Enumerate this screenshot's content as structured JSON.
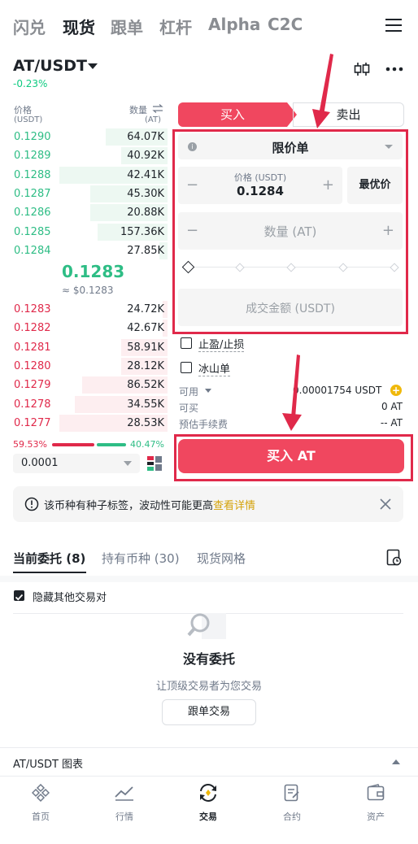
{
  "top_nav": {
    "tabs": [
      {
        "label": "闪兑",
        "active": false
      },
      {
        "label": "现货",
        "active": true
      },
      {
        "label": "跟单",
        "active": false
      },
      {
        "label": "杠杆",
        "active": false
      },
      {
        "label": "Alpha",
        "active": false
      },
      {
        "label": "C2C",
        "active": false
      }
    ],
    "menu_icon": "hamburger-icon"
  },
  "header": {
    "pair": "AT/USDT",
    "change": "-0.23%",
    "icons": [
      "candlestick-icon",
      "more-icon"
    ]
  },
  "orderbook": {
    "price_header": "价格",
    "price_unit": "(USDT)",
    "qty_header": "数量",
    "qty_unit": "(AT)",
    "bids": [
      {
        "price": "0.1290",
        "qty": "64.07K",
        "depth": 0.4
      },
      {
        "price": "0.1289",
        "qty": "40.92K",
        "depth": 0.3
      },
      {
        "price": "0.1288",
        "qty": "42.41K",
        "depth": 0.7
      },
      {
        "price": "0.1287",
        "qty": "45.30K",
        "depth": 0.5
      },
      {
        "price": "0.1286",
        "qty": "20.88K",
        "depth": 0.5
      },
      {
        "price": "0.1285",
        "qty": "157.36K",
        "depth": 0.45
      },
      {
        "price": "0.1284",
        "qty": "27.85K",
        "depth": 0.05
      }
    ],
    "mid_price": "0.1283",
    "mid_usd": "≈ $0.1283",
    "asks": [
      {
        "price": "0.1283",
        "qty": "24.72K",
        "depth": 0.03
      },
      {
        "price": "0.1282",
        "qty": "42.67K",
        "depth": 0.03
      },
      {
        "price": "0.1281",
        "qty": "58.91K",
        "depth": 0.3
      },
      {
        "price": "0.1280",
        "qty": "28.12K",
        "depth": 0.3
      },
      {
        "price": "0.1279",
        "qty": "86.52K",
        "depth": 0.55
      },
      {
        "price": "0.1278",
        "qty": "34.55K",
        "depth": 0.6
      },
      {
        "price": "0.1277",
        "qty": "28.53K",
        "depth": 0.7
      }
    ],
    "sell_ratio": "59.53%",
    "buy_ratio": "40.47%",
    "precision": "0.0001"
  },
  "order_form": {
    "buy_tab": "买入",
    "sell_tab": "卖出",
    "order_type": "限价单",
    "price_label": "价格 (USDT)",
    "price_value": "0.1284",
    "best_price": "最优价",
    "qty_placeholder": "数量 (AT)",
    "total_placeholder": "成交金额 (USDT)",
    "tp_sl": "止盈/止损",
    "iceberg": "冰山单",
    "available_label": "可用",
    "available_value": "0.00001754 USDT",
    "can_buy_label": "可买",
    "can_buy_value": "0 AT",
    "fee_label": "预估手续费",
    "fee_value": "-- AT",
    "submit": "买入 AT",
    "slider_level": 0
  },
  "notice": {
    "text": "该币种有种子标签，波动性可能更高",
    "link": "查看详情"
  },
  "orders_section": {
    "tabs": [
      {
        "label": "当前委托 (8)",
        "active": true
      },
      {
        "label": "持有币种 (30)",
        "active": false
      },
      {
        "label": "现货网格",
        "active": false
      }
    ],
    "hide_others": "隐藏其他交易对",
    "empty_title": "没有委托",
    "empty_sub": "让顶级交易者为您交易",
    "copy_trading_btn": "跟单交易"
  },
  "chart_bar": {
    "label": "AT/USDT 图表"
  },
  "bottom_nav": [
    {
      "label": "首页",
      "icon": "home-icon",
      "active": false
    },
    {
      "label": "行情",
      "icon": "market-icon",
      "active": false
    },
    {
      "label": "交易",
      "icon": "trade-icon",
      "active": true
    },
    {
      "label": "合约",
      "icon": "futures-icon",
      "active": false
    },
    {
      "label": "资产",
      "icon": "wallet-icon",
      "active": false
    }
  ],
  "colors": {
    "buy": "#f0475f",
    "bid_green": "#2ebd85",
    "ask_red": "#e0294a",
    "annotation_red": "#e0294a",
    "link_gold": "#d4a20a"
  }
}
